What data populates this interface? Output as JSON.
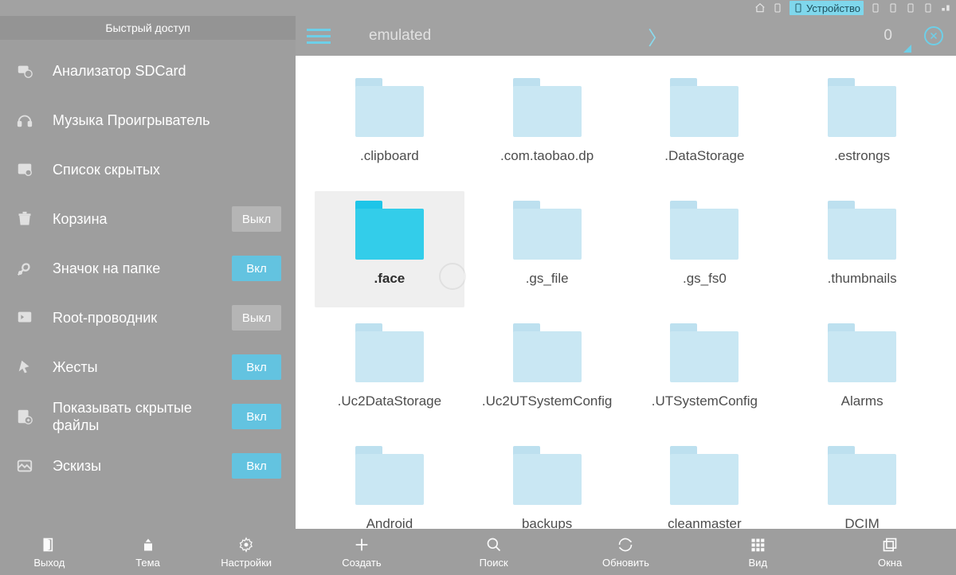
{
  "systembar": {
    "device_label": "Устройство"
  },
  "sidebar": {
    "title": "Быстрый доступ",
    "items": [
      {
        "label": "Анализатор SDCard",
        "toggle": null
      },
      {
        "label": "Музыка Проигрыватель",
        "toggle": null
      },
      {
        "label": "Список скрытых",
        "toggle": null
      },
      {
        "label": "Корзина",
        "toggle": "off"
      },
      {
        "label": "Значок на папке",
        "toggle": "on"
      },
      {
        "label": "Root-проводник",
        "toggle": "off"
      },
      {
        "label": "Жесты",
        "toggle": "on"
      },
      {
        "label": "Показывать скрытые файлы",
        "toggle": "on"
      },
      {
        "label": "Эскизы",
        "toggle": "on"
      }
    ],
    "toggle_labels": {
      "on": "Вкл",
      "off": "Выкл"
    }
  },
  "path": {
    "segments": [
      "emulated",
      "0"
    ]
  },
  "folders": [
    {
      "name": ".clipboard",
      "selected": false
    },
    {
      "name": ".com.taobao.dp",
      "selected": false
    },
    {
      "name": ".DataStorage",
      "selected": false
    },
    {
      "name": ".estrongs",
      "selected": false
    },
    {
      "name": ".face",
      "selected": true
    },
    {
      "name": ".gs_file",
      "selected": false
    },
    {
      "name": ".gs_fs0",
      "selected": false
    },
    {
      "name": ".thumbnails",
      "selected": false
    },
    {
      "name": ".Uc2DataStorage",
      "selected": false
    },
    {
      "name": ".Uc2UTSystemConfig",
      "selected": false
    },
    {
      "name": ".UTSystemConfig",
      "selected": false
    },
    {
      "name": "Alarms",
      "selected": false
    },
    {
      "name": "Android",
      "selected": false
    },
    {
      "name": "backups",
      "selected": false
    },
    {
      "name": "cleanmaster",
      "selected": false
    },
    {
      "name": "DCIM",
      "selected": false
    }
  ],
  "bottombar": {
    "left": [
      "Выход",
      "Тема",
      "Настройки"
    ],
    "right": [
      "Создать",
      "Поиск",
      "Обновить",
      "Вид",
      "Окна"
    ]
  }
}
